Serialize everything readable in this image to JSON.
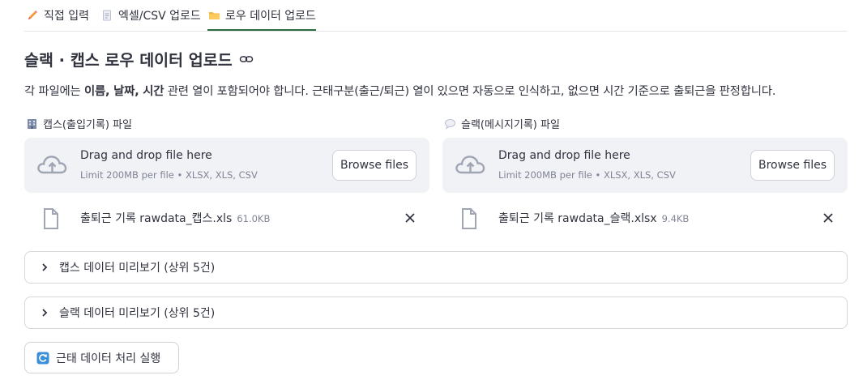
{
  "tabs": [
    {
      "label": "직접 입력",
      "icon": "pencil-icon"
    },
    {
      "label": "엑셀/CSV 업로드",
      "icon": "document-icon"
    },
    {
      "label": "로우 데이터 업로드",
      "icon": "folder-icon",
      "active": true
    }
  ],
  "header": {
    "title": "슬랙 · 캡스 로우 데이터 업로드",
    "link_icon": "link-icon"
  },
  "description": {
    "prefix": "각 파일에는 ",
    "bold1": "이름, 날짜, 시간",
    "suffix": " 관련 열이 포함되어야 합니다. 근태구분(출근/퇴근) 열이 있으면 자동으로 인식하고, 없으면 시간 기준으로 출퇴근을 판정합니다."
  },
  "uploaders": [
    {
      "label": "캡스(출입기록) 파일",
      "label_icon": "building-icon",
      "drop_title": "Drag and drop file here",
      "drop_limit": "Limit 200MB per file • XLSX, XLS, CSV",
      "browse_label": "Browse files",
      "file_name": "출퇴근 기록 rawdata_캡스.xls",
      "file_size": "61.0KB"
    },
    {
      "label": "슬랙(메시지기록) 파일",
      "label_icon": "speech-bubble-icon",
      "drop_title": "Drag and drop file here",
      "drop_limit": "Limit 200MB per file • XLSX, XLS, CSV",
      "browse_label": "Browse files",
      "file_name": "출퇴근 기록 rawdata_슬랙.xlsx",
      "file_size": "9.4KB"
    }
  ],
  "expanders": [
    {
      "label": "캡스 데이터 미리보기 (상위 5건)"
    },
    {
      "label": "슬랙 데이터 미리보기 (상위 5건)"
    }
  ],
  "run_button": {
    "label": "근태 데이터 처리 실행",
    "icon": "refresh-icon"
  },
  "colors": {
    "accent": "#2e6b3c",
    "dropzone_bg": "#f0f2f6",
    "text": "#31333f",
    "muted": "#808495"
  }
}
